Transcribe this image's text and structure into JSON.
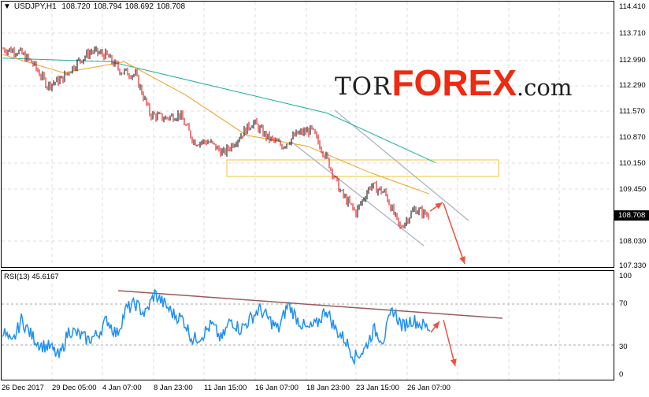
{
  "header": {
    "symbol": "USDJPY,H1",
    "open": "108.720",
    "high": "108.794",
    "low": "108.692",
    "close": "108.708"
  },
  "logo": {
    "tor": "TOR",
    "forex": "FOREX",
    ".com": ".com"
  },
  "price_axis": [
    "114.410",
    "113.710",
    "112.990",
    "112.290",
    "111.570",
    "110.870",
    "110.150",
    "109.450",
    "108.030",
    "107.330"
  ],
  "current_price": "108.708",
  "rsi": {
    "title": "RSI(13) 45.6167",
    "levels": [
      "100",
      "70",
      "30",
      "0"
    ]
  },
  "time_axis": [
    "26 Dec 2017",
    "29 Dec 05:00",
    "4 Jan 07:00",
    "8 Jan 23:00",
    "11 Jan 15:00",
    "16 Jan 07:00",
    "18 Jan 23:00",
    "23 Jan 15:00",
    "26 Jan 07:00"
  ],
  "colors": {
    "bull": "#000000",
    "bear": "#e00000",
    "ma_fast": "#f0a020",
    "ma_slow": "#20b0a0",
    "rsi": "#2090f0",
    "arrow": "#f05040",
    "zone": "#f0c040"
  },
  "chart_data": {
    "type": "candlestick",
    "price_range": [
      107.33,
      114.41
    ],
    "price_path": [
      113.25,
      113.19,
      112.86,
      112.26,
      112.43,
      112.87,
      113.19,
      113.08,
      112.65,
      112.54,
      111.47,
      111.36,
      111.47,
      110.72,
      110.72,
      110.4,
      110.83,
      111.26,
      110.83,
      110.61,
      110.93,
      111.04,
      110.29,
      109.32,
      108.79,
      109.54,
      109.32,
      108.36,
      108.89,
      108.71
    ],
    "ma_fast": [
      113.1,
      112.6,
      112.9,
      112.0,
      110.9,
      110.6,
      109.9,
      109.3
    ],
    "ma_slow": [
      113.0,
      112.9,
      112.2,
      111.5,
      110.15
    ],
    "rsi_path": [
      45,
      30,
      55,
      40,
      30,
      28,
      18,
      45,
      40,
      35,
      40,
      55,
      40,
      65,
      70,
      60,
      80,
      70,
      60,
      55,
      35,
      40,
      50,
      35,
      55,
      45,
      55,
      65,
      55,
      45,
      70,
      55,
      45,
      50,
      65,
      45,
      35,
      18,
      25,
      45,
      35,
      65,
      48,
      55,
      50,
      46
    ]
  }
}
